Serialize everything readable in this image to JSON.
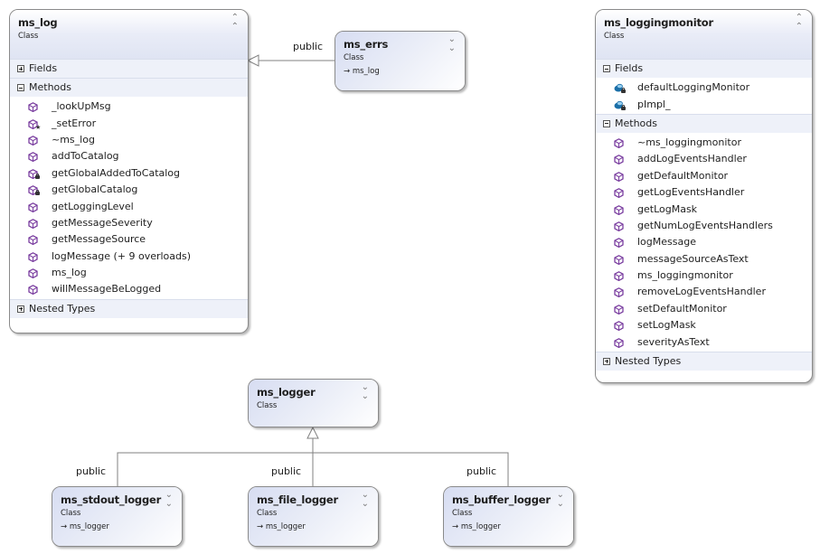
{
  "diagram": {
    "relation_label": "public",
    "classes": {
      "ms_log": {
        "name": "ms_log",
        "kind": "Class",
        "sections": {
          "fields": {
            "label": "Fields",
            "expanded": false
          },
          "methods": {
            "label": "Methods",
            "expanded": true
          },
          "nested": {
            "label": "Nested Types",
            "expanded": false
          }
        },
        "methods": [
          {
            "name": "_lookUpMsg",
            "icon": "method-icon",
            "modifier": ""
          },
          {
            "name": "_setError",
            "icon": "method-icon",
            "modifier": "protected-star"
          },
          {
            "name": "~ms_log",
            "icon": "method-icon",
            "modifier": ""
          },
          {
            "name": "addToCatalog",
            "icon": "method-icon",
            "modifier": ""
          },
          {
            "name": "getGlobalAddedToCatalog",
            "icon": "method-icon",
            "modifier": "private-lock"
          },
          {
            "name": "getGlobalCatalog",
            "icon": "method-icon",
            "modifier": "private-lock"
          },
          {
            "name": "getLoggingLevel",
            "icon": "method-icon",
            "modifier": ""
          },
          {
            "name": "getMessageSeverity",
            "icon": "method-icon",
            "modifier": ""
          },
          {
            "name": "getMessageSource",
            "icon": "method-icon",
            "modifier": ""
          },
          {
            "name": "logMessage (+ 9 overloads)",
            "icon": "method-icon",
            "modifier": ""
          },
          {
            "name": "ms_log",
            "icon": "method-icon",
            "modifier": ""
          },
          {
            "name": "willMessageBeLogged",
            "icon": "method-icon",
            "modifier": ""
          }
        ]
      },
      "ms_errs": {
        "name": "ms_errs",
        "kind": "Class",
        "base": "ms_log"
      },
      "ms_loggingmonitor": {
        "name": "ms_loggingmonitor",
        "kind": "Class",
        "sections": {
          "fields": {
            "label": "Fields",
            "expanded": true
          },
          "methods": {
            "label": "Methods",
            "expanded": true
          },
          "nested": {
            "label": "Nested Types",
            "expanded": false
          }
        },
        "fields": [
          {
            "name": "defaultLoggingMonitor",
            "icon": "field-icon",
            "modifier": "private-lock"
          },
          {
            "name": "pImpl_",
            "icon": "field-icon",
            "modifier": "private-lock"
          }
        ],
        "methods": [
          {
            "name": "~ms_loggingmonitor",
            "icon": "method-icon",
            "modifier": ""
          },
          {
            "name": "addLogEventsHandler",
            "icon": "method-icon",
            "modifier": ""
          },
          {
            "name": "getDefaultMonitor",
            "icon": "method-icon",
            "modifier": ""
          },
          {
            "name": "getLogEventsHandler",
            "icon": "method-icon",
            "modifier": ""
          },
          {
            "name": "getLogMask",
            "icon": "method-icon",
            "modifier": ""
          },
          {
            "name": "getNumLogEventsHandlers",
            "icon": "method-icon",
            "modifier": ""
          },
          {
            "name": "logMessage",
            "icon": "method-icon",
            "modifier": ""
          },
          {
            "name": "messageSourceAsText",
            "icon": "method-icon",
            "modifier": ""
          },
          {
            "name": "ms_loggingmonitor",
            "icon": "method-icon",
            "modifier": ""
          },
          {
            "name": "removeLogEventsHandler",
            "icon": "method-icon",
            "modifier": ""
          },
          {
            "name": "setDefaultMonitor",
            "icon": "method-icon",
            "modifier": ""
          },
          {
            "name": "setLogMask",
            "icon": "method-icon",
            "modifier": ""
          },
          {
            "name": "severityAsText",
            "icon": "method-icon",
            "modifier": ""
          }
        ]
      },
      "ms_logger": {
        "name": "ms_logger",
        "kind": "Class"
      },
      "ms_stdout_logger": {
        "name": "ms_stdout_logger",
        "kind": "Class",
        "base": "ms_logger"
      },
      "ms_file_logger": {
        "name": "ms_file_logger",
        "kind": "Class",
        "base": "ms_logger"
      },
      "ms_buffer_logger": {
        "name": "ms_buffer_logger",
        "kind": "Class",
        "base": "ms_logger"
      }
    },
    "colors": {
      "method_icon": "#7b3fa0",
      "field_icon": "#1b6fa8",
      "section_bg": "#eef1f9",
      "connector": "#808080"
    }
  }
}
